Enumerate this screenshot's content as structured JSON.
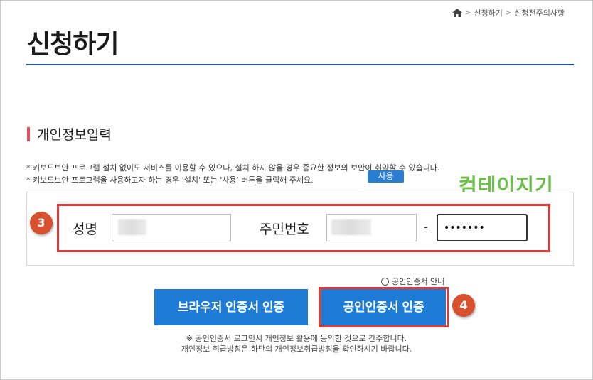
{
  "breadcrumb": {
    "home_icon": "home-icon",
    "items": [
      "신청하기",
      "신청전주의사항"
    ],
    "separator": ">"
  },
  "page": {
    "title": "신청하기"
  },
  "section": {
    "title": "개인정보입력",
    "accent_color": "#e0525f"
  },
  "notices": [
    "* 키보드보안 프로그램 설치 없이도 서비스를 이용할 수 있으나, 설치 하지 않을 경우 중요한 정보의 보안이 취약할 수 있습니다.",
    "* 키보드보안 프로그램을 사용하고자 하는 경우 '설치' 또는 '사용' 버튼을 클릭해 주세요."
  ],
  "use_button": "사용",
  "watermark": "컴테이지기",
  "form": {
    "name_label": "성명",
    "name_value": "",
    "rrn_label": "주민번호",
    "rrn_front_value": "",
    "rrn_separator": "-",
    "rrn_back_value": "•••••••"
  },
  "steps": {
    "step3": "3",
    "step4": "4"
  },
  "guide_link": {
    "icon": "info-icon",
    "icon_glyph": "i",
    "label": "공인인증서 안내"
  },
  "buttons": {
    "browser_cert": "브라우저 인증서 인증",
    "public_cert": "공인인증서 인증"
  },
  "footnotes": [
    "※ 공인인증서 로그인시 개인정보 활용에 동의한 것으로 간주합니다.",
    "개인정보 취급방침은 하단의 개인정보취급방침을 확인하시기 바랍니다."
  ],
  "colors": {
    "primary_button": "#1f7cd6",
    "highlight": "#e53935",
    "step_badge": "#d8502d",
    "title_rule": "#1f5a96",
    "watermark": "#6cc04a"
  }
}
